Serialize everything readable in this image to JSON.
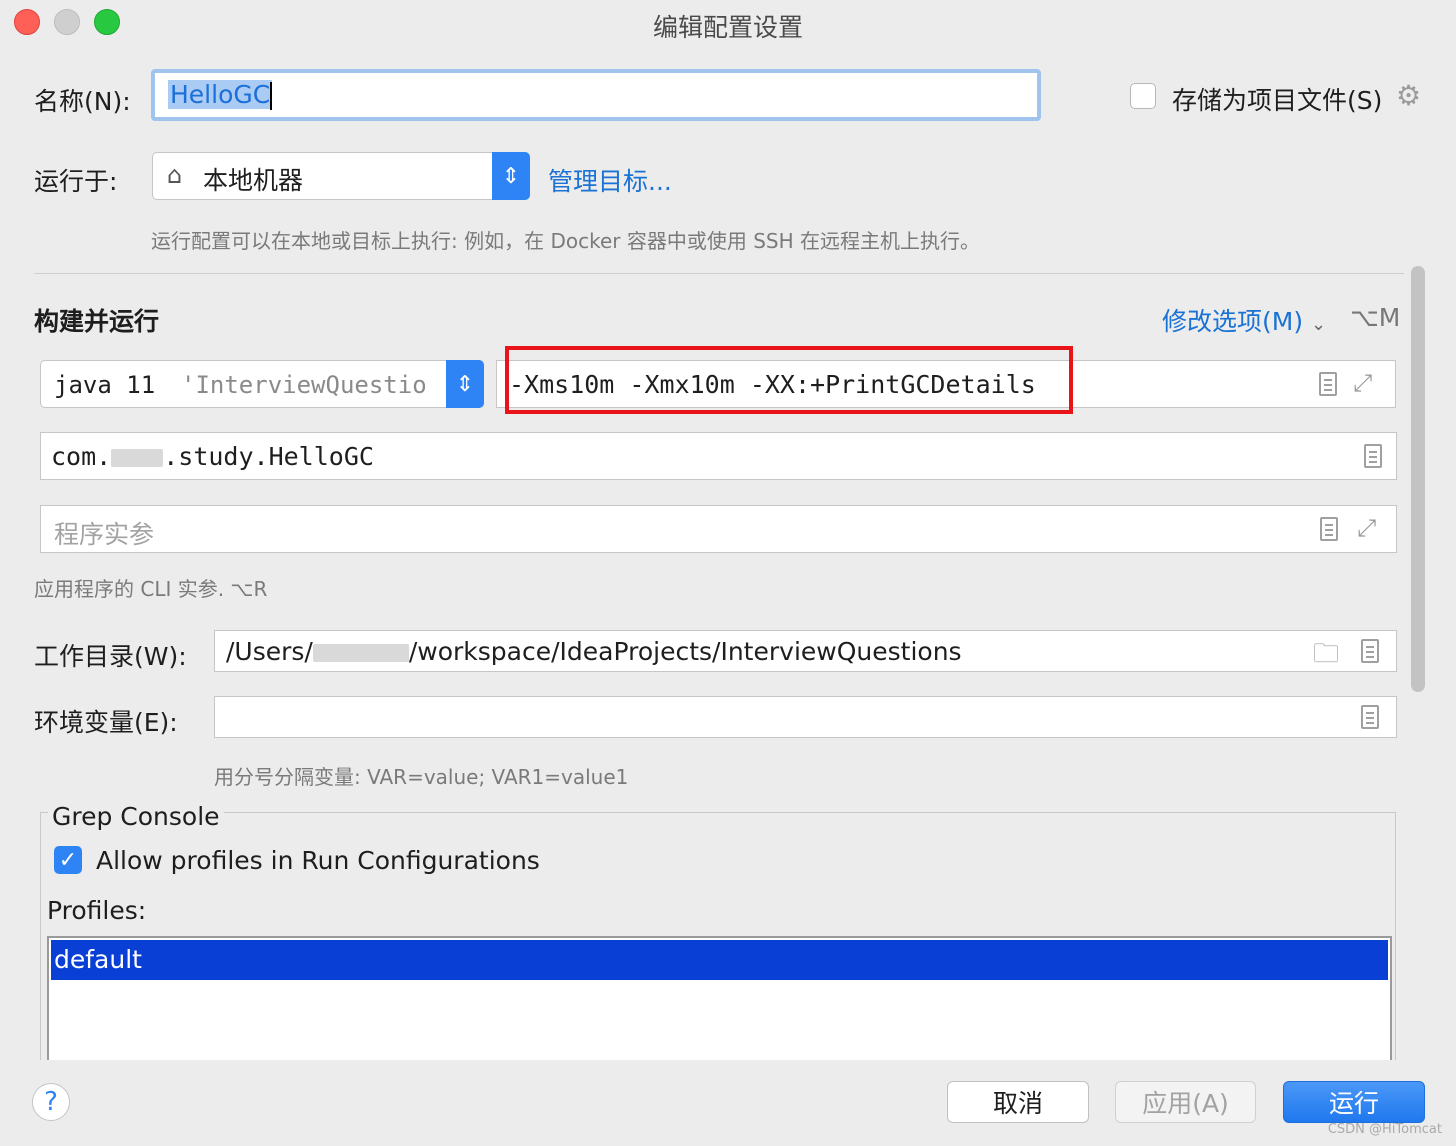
{
  "window": {
    "title": "编辑配置设置"
  },
  "name": {
    "label": "名称(N):",
    "value_selected": "HelloGC"
  },
  "store_as_project": {
    "label": "存储为项目文件(S)",
    "checked": false
  },
  "run_on": {
    "label": "运行于:",
    "value": "本地机器",
    "manage_link": "管理目标...",
    "hint": "运行配置可以在本地或目标上执行: 例如，在 Docker 容器中或使用 SSH 在远程主机上执行。"
  },
  "build_run": {
    "title": "构建并运行",
    "modify_options": "修改选项(M)",
    "modify_shortcut": "⌥M",
    "jre": {
      "value": "java 11",
      "project": "'InterviewQuestio"
    },
    "vm_options": "-Xms10m -Xmx10m -XX:+PrintGCDetails",
    "main_class": {
      "prefix": "com.",
      "suffix": ".study.HelloGC"
    },
    "program_args": {
      "placeholder": "程序实参"
    },
    "program_args_hint": "应用程序的 CLI 实参. ⌥R"
  },
  "working_dir": {
    "label": "工作目录(W):",
    "prefix": "/Users/",
    "suffix": "/workspace/IdeaProjects/InterviewQuestions"
  },
  "env_vars": {
    "label": "环境变量(E):",
    "value": "",
    "hint": "用分号分隔变量: VAR=value; VAR1=value1"
  },
  "grep_console": {
    "title": "Grep Console",
    "allow_profiles": "Allow profiles in Run Configurations",
    "allow_checked": true,
    "profiles_label": "Profiles:",
    "profiles": [
      "default"
    ]
  },
  "footer": {
    "help": "?",
    "cancel": "取消",
    "apply": "应用(A)",
    "run": "运行"
  },
  "watermark": "CSDN @HiTomcat",
  "colors": {
    "accent": "#2f84f5",
    "highlight_border": "#e8141a",
    "selection": "#0a3fd6",
    "link": "#1a72d4"
  }
}
